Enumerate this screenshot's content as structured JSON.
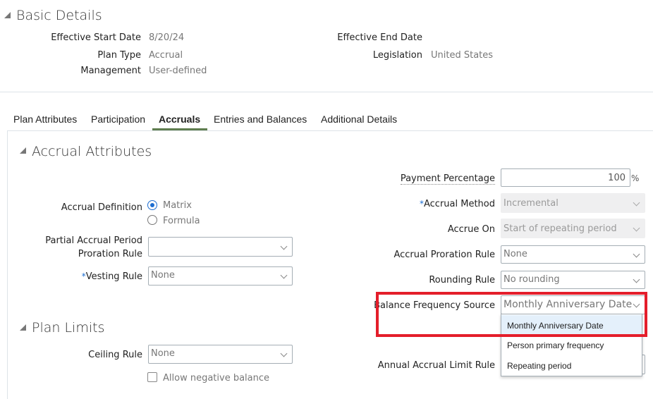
{
  "basic_details": {
    "title": "Basic Details",
    "fields": {
      "effective_start_date": {
        "label": "Effective Start Date",
        "value": "8/20/24"
      },
      "plan_type": {
        "label": "Plan Type",
        "value": "Accrual"
      },
      "management": {
        "label": "Management",
        "value": "User-defined"
      },
      "effective_end_date": {
        "label": "Effective End Date",
        "value": ""
      },
      "legislation": {
        "label": "Legislation",
        "value": "United States"
      }
    }
  },
  "tabs": [
    {
      "label": "Plan Attributes",
      "active": false
    },
    {
      "label": "Participation",
      "active": false
    },
    {
      "label": "Accruals",
      "active": true
    },
    {
      "label": "Entries and Balances",
      "active": false
    },
    {
      "label": "Additional Details",
      "active": false
    }
  ],
  "accrual_attributes": {
    "title": "Accrual Attributes",
    "accrual_definition": {
      "label": "Accrual Definition",
      "options": [
        "Matrix",
        "Formula"
      ],
      "selected": "Matrix"
    },
    "partial_accrual": {
      "label_line1": "Partial Accrual Period",
      "label_line2": "Proration Rule",
      "value": ""
    },
    "vesting_rule": {
      "required_mark": "*",
      "label": "Vesting Rule",
      "value": "None"
    },
    "payment_percentage": {
      "label": "Payment Percentage",
      "value": "100",
      "unit": "%"
    },
    "accrual_method": {
      "required_mark": "*",
      "label": "Accrual Method",
      "value": "Incremental"
    },
    "accrue_on": {
      "label": "Accrue On",
      "value": "Start of repeating period"
    },
    "accrual_proration_rule": {
      "label": "Accrual Proration Rule",
      "value": "None"
    },
    "rounding_rule": {
      "label": "Rounding Rule",
      "value": "No rounding"
    },
    "balance_frequency_source": {
      "label": "Balance Frequency Source",
      "value": "Monthly Anniversary Date",
      "options": [
        "Monthly Anniversary Date",
        "Person primary frequency",
        "Repeating period"
      ],
      "highlighted": "Monthly Anniversary Date"
    },
    "annual_accrual_limit_rule": {
      "label": "Annual Accrual Limit Rule"
    }
  },
  "plan_limits": {
    "title": "Plan Limits",
    "ceiling_rule": {
      "label": "Ceiling Rule",
      "value": "None"
    },
    "allow_negative_balance": {
      "label": "Allow negative balance",
      "checked": false
    }
  },
  "annotation": {
    "color": "#e41e2b"
  }
}
